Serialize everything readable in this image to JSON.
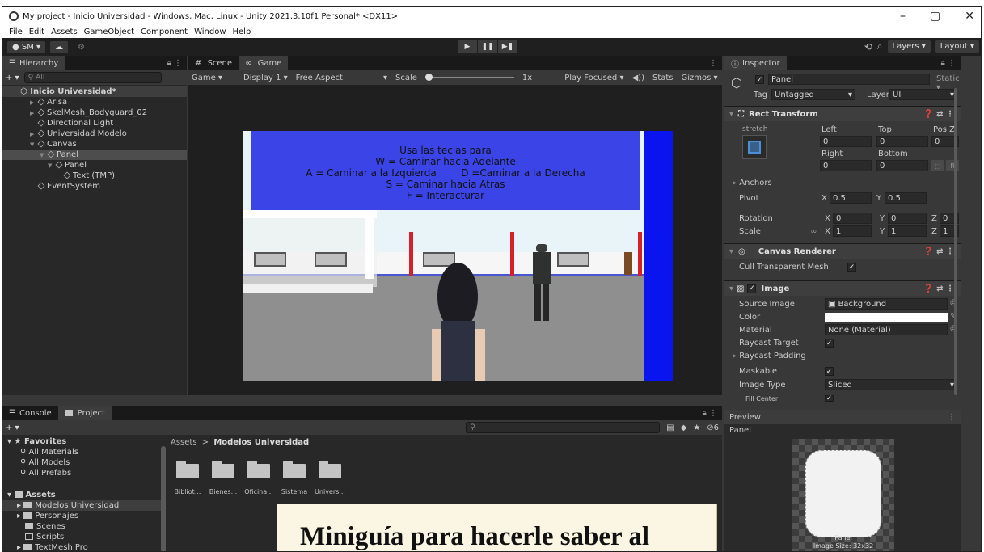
{
  "window": {
    "title": "My project - Inicio Universidad - Windows, Mac, Linux - Unity 2021.3.10f1 Personal* <DX11>",
    "controls": [
      "–",
      "▢",
      "✕"
    ]
  },
  "menu": [
    "File",
    "Edit",
    "Assets",
    "GameObject",
    "Component",
    "Window",
    "Help"
  ],
  "toolbar": {
    "account": "SM ▾",
    "cloud": "☁",
    "settings": "⚙",
    "play": "▶",
    "pause": "❚❚",
    "step": "▶❚",
    "history": "⟲",
    "search": "⌕",
    "layers": "Layers",
    "layout": "Layout"
  },
  "hierarchy": {
    "tab": "Hierarchy",
    "search_placeholder": "All",
    "scene": "Inicio Universidad*",
    "items": [
      {
        "label": "Arisa",
        "depth": 1
      },
      {
        "label": "SkelMesh_Bodyguard_02",
        "depth": 1
      },
      {
        "label": "Directional Light",
        "depth": 1
      },
      {
        "label": "Universidad Modelo",
        "depth": 1
      },
      {
        "label": "Canvas",
        "depth": 1
      },
      {
        "label": "Panel",
        "depth": 2,
        "selected": true
      },
      {
        "label": "Panel",
        "depth": 3
      },
      {
        "label": "Text (TMP)",
        "depth": 4
      },
      {
        "label": "EventSystem",
        "depth": 1
      }
    ]
  },
  "game": {
    "tabs": [
      "Scene",
      "Game"
    ],
    "display_mode": "Game",
    "display": "Display 1",
    "aspect": "Free Aspect",
    "scale_label": "Scale",
    "scale_value": "1x",
    "play_focused": "Play Focused",
    "stats": "Stats",
    "gizmos": "Gizmos",
    "instructions": [
      "Usa las teclas para",
      "W = Caminar hacia Adelante",
      "A = Caminar a la Izquierda        D =Caminar a la Derecha",
      "S = Caminar hacia Atras",
      "F = Interacturar"
    ],
    "colors": {
      "banner": "#3b44e6",
      "blue_bar": "#0a14ee",
      "floor": "#8f8f8f",
      "sky": "#e9f4f8",
      "wall": "#f6f6f6",
      "red_pillar": "#d4202a"
    }
  },
  "inspector": {
    "tab": "Inspector",
    "object_name": "Panel",
    "static_label": "Static",
    "tag_label": "Tag",
    "tag_value": "Untagged",
    "layer_label": "Layer",
    "layer_value": "UI",
    "rect_transform": {
      "title": "Rect Transform",
      "anchor_preset": "stretch",
      "left_label": "Left",
      "left": "0",
      "top_label": "Top",
      "top": "0",
      "posz_label": "Pos Z",
      "posz": "0",
      "right_label": "Right",
      "right": "0",
      "bottom_label": "Bottom",
      "bottom": "0",
      "anchors": "Anchors",
      "pivot_label": "Pivot",
      "pivot_x": "0.5",
      "pivot_y": "0.5",
      "rotation_label": "Rotation",
      "rot_x": "0",
      "rot_y": "0",
      "rot_z": "0",
      "scale_label": "Scale",
      "scale_x": "1",
      "scale_y": "1",
      "scale_z": "1",
      "raw_btn": "R"
    },
    "canvas_renderer": {
      "title": "Canvas Renderer",
      "cull_label": "Cull Transparent Mesh"
    },
    "image": {
      "title": "Image",
      "source_label": "Source Image",
      "source_value": "Background",
      "color_label": "Color",
      "material_label": "Material",
      "material_value": "None (Material)",
      "raycast_label": "Raycast Target",
      "padding_label": "Raycast Padding",
      "maskable_label": "Maskable",
      "type_label": "Image Type",
      "type_value": "Sliced",
      "fill_label": "Fill Center"
    },
    "preview": {
      "tab": "Preview",
      "object": "Panel",
      "caption": "Panel",
      "size": "Image Size: 32x32"
    }
  },
  "bottom": {
    "tabs": [
      "Console",
      "Project"
    ],
    "counter": "6",
    "favorites_title": "Favorites",
    "favorites": [
      "All Materials",
      "All Models",
      "All Prefabs"
    ],
    "assets_title": "Assets",
    "assets_tree": [
      "Modelos Universidad",
      "Personajes",
      "Scenes",
      "Scripts",
      "TextMesh Pro"
    ],
    "breadcrumb_root": "Assets",
    "breadcrumb_sep": ">",
    "breadcrumb_current": "Modelos Universidad",
    "folders": [
      "Bibliot...",
      "Bienes...",
      "Oficina...",
      "Sistema",
      "Univers..."
    ]
  },
  "overlay_caption": "Miniguía para hacerle saber al"
}
